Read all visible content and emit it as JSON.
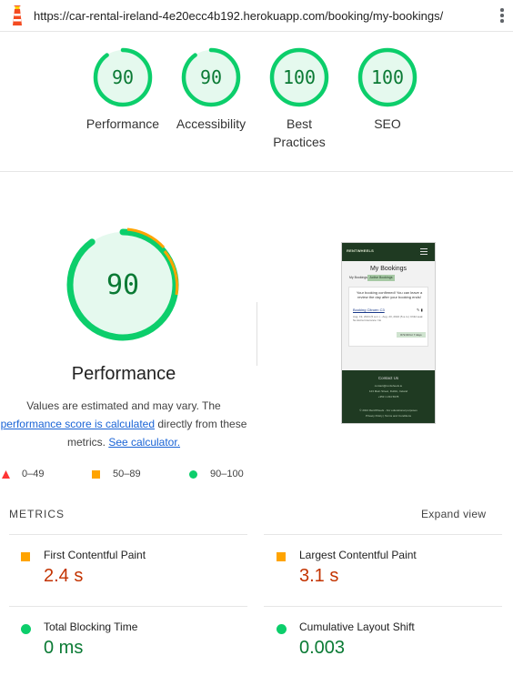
{
  "browser": {
    "url": "https://car-rental-ireland-4e20ecc4b192.herokuapp.com/booking/my-bookings/",
    "logo_icon": "lighthouse-icon",
    "menu_icon": "kebab-menu-icon"
  },
  "categories": [
    {
      "label": "Performance",
      "score": "90",
      "fraction": 0.9
    },
    {
      "label": "Accessibility",
      "score": "90",
      "fraction": 0.9
    },
    {
      "label": "Best Practices",
      "score": "100",
      "fraction": 1.0
    },
    {
      "label": "SEO",
      "score": "100",
      "fraction": 1.0
    }
  ],
  "performance": {
    "score": "90",
    "fraction": 0.9,
    "title": "Performance",
    "desc_part1": "Values are estimated and may vary. The",
    "desc_link1": "performance score is calculated",
    "desc_part2": "directly from these metrics.",
    "desc_link2": "See calculator."
  },
  "legend": {
    "fail": "0–49",
    "average": "50–89",
    "pass": "90–100"
  },
  "thumbnail": {
    "logo": "RENTWHEELS",
    "page_title": "My Bookings",
    "tab_my_bookings": "My Bookings",
    "tab_active": "Active Bookings",
    "message": "Your booking confirmed! You can leave a review the day after your booking ends!",
    "booking_link": "Booking Citroen C3",
    "dates": "Aug. 19, 2024 (5 a.m.) - Aug. 23, 2024 (5 a.m.) Child seat: No Extra Insurance: No",
    "price": "€72.00 for 7 days",
    "footer_heading": "Contact Us",
    "footer_email": "contact@rentwheels.ie",
    "footer_address": "123 Main Street, Dublin, Ireland",
    "footer_phone": "+353 1 234 5678",
    "footer_copyright": "© 2024 RentWheels - For educational purposes",
    "footer_links": "Privacy Policy | Terms and Conditions"
  },
  "metrics": {
    "heading": "METRICS",
    "expand_label": "Expand view",
    "items": [
      {
        "name": "First Contentful Paint",
        "value": "2.4 s",
        "status": "average"
      },
      {
        "name": "Largest Contentful Paint",
        "value": "3.1 s",
        "status": "average"
      },
      {
        "name": "Total Blocking Time",
        "value": "0 ms",
        "status": "pass"
      },
      {
        "name": "Cumulative Layout Shift",
        "value": "0.003",
        "status": "pass"
      }
    ]
  },
  "colors": {
    "pass": "#0cce6b",
    "pass_text": "#0a7a34",
    "average": "#ffa400",
    "average_text": "#c33300",
    "fail": "#ff3333",
    "link": "#1a64d6"
  }
}
